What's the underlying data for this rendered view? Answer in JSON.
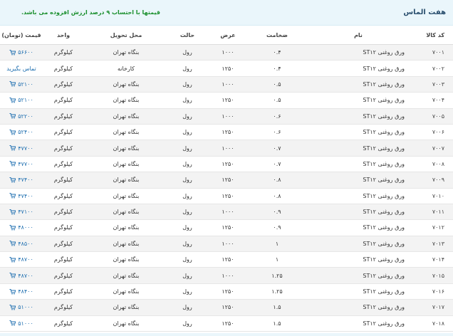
{
  "brand": "هفت الماس",
  "notice": "قیمتها با احتساب ۹ درصد ارزش افزوده می باشد.",
  "headers": {
    "code": "کد کالا",
    "name": "نام",
    "thickness": "ضخامت",
    "width": "عرض",
    "form": "حالت",
    "delivery": "محل تحویل",
    "unit": "واحد",
    "price": "قیمت (تومان)"
  },
  "rows": [
    {
      "code": "۷۰۰۱",
      "name": "ورق روغنی ST۱۲",
      "thickness": "۰.۴",
      "width": "۱۰۰۰",
      "form": "رول",
      "delivery": "بنگاه تهران",
      "unit": "کیلوگرم",
      "price": "۵۶۶۰۰",
      "has_cart": true
    },
    {
      "code": "۷۰۰۲",
      "name": "ورق روغنی ST۱۲",
      "thickness": "۰.۴",
      "width": "۱۲۵۰",
      "form": "رول",
      "delivery": "کارخانه",
      "unit": "کیلوگرم",
      "price": "تماس بگیرید",
      "has_cart": false
    },
    {
      "code": "۷۰۰۳",
      "name": "ورق روغنی ST۱۲",
      "thickness": "۰.۵",
      "width": "۱۰۰۰",
      "form": "رول",
      "delivery": "بنگاه تهران",
      "unit": "کیلوگرم",
      "price": "۵۲۱۰۰",
      "has_cart": true
    },
    {
      "code": "۷۰۰۴",
      "name": "ورق روغنی ST۱۲",
      "thickness": "۰.۵",
      "width": "۱۲۵۰",
      "form": "رول",
      "delivery": "بنگاه تهران",
      "unit": "کیلوگرم",
      "price": "۵۲۱۰۰",
      "has_cart": true
    },
    {
      "code": "۷۰۰۵",
      "name": "ورق روغنی ST۱۲",
      "thickness": "۰.۶",
      "width": "۱۰۰۰",
      "form": "رول",
      "delivery": "بنگاه تهران",
      "unit": "کیلوگرم",
      "price": "۵۲۲۰۰",
      "has_cart": true
    },
    {
      "code": "۷۰۰۶",
      "name": "ورق روغنی ST۱۲",
      "thickness": "۰.۶",
      "width": "۱۲۵۰",
      "form": "رول",
      "delivery": "بنگاه تهران",
      "unit": "کیلوگرم",
      "price": "۵۲۴۰۰",
      "has_cart": true
    },
    {
      "code": "۷۰۰۷",
      "name": "ورق روغنی ST۱۲",
      "thickness": "۰.۷",
      "width": "۱۰۰۰",
      "form": "رول",
      "delivery": "بنگاه تهران",
      "unit": "کیلوگرم",
      "price": "۴۷۷۰۰",
      "has_cart": true
    },
    {
      "code": "۷۰۰۸",
      "name": "ورق روغنی ST۱۲",
      "thickness": "۰.۷",
      "width": "۱۲۵۰",
      "form": "رول",
      "delivery": "بنگاه تهران",
      "unit": "کیلوگرم",
      "price": "۴۷۷۰۰",
      "has_cart": true
    },
    {
      "code": "۷۰۰۹",
      "name": "ورق روغنی ST۱۲",
      "thickness": "۰.۸",
      "width": "۱۲۵۰",
      "form": "رول",
      "delivery": "بنگاه تهران",
      "unit": "کیلوگرم",
      "price": "۴۷۴۰۰",
      "has_cart": true
    },
    {
      "code": "۷۰۱۰",
      "name": "ورق روغنی ST۱۲",
      "thickness": "۰.۸",
      "width": "۱۲۵۰",
      "form": "رول",
      "delivery": "بنگاه تهران",
      "unit": "کیلوگرم",
      "price": "۴۷۴۰۰",
      "has_cart": true
    },
    {
      "code": "۷۰۱۱",
      "name": "ورق روغنی ST۱۲",
      "thickness": "۰.۹",
      "width": "۱۰۰۰",
      "form": "رول",
      "delivery": "بنگاه تهران",
      "unit": "کیلوگرم",
      "price": "۴۷۱۰۰",
      "has_cart": true
    },
    {
      "code": "۷۰۱۲",
      "name": "ورق روغنی ST۱۲",
      "thickness": "۰.۹",
      "width": "۱۲۵۰",
      "form": "رول",
      "delivery": "بنگاه تهران",
      "unit": "کیلوگرم",
      "price": "۴۸۰۰۰",
      "has_cart": true
    },
    {
      "code": "۷۰۱۳",
      "name": "ورق روغنی ST۱۲",
      "thickness": "۱",
      "width": "۱۰۰۰",
      "form": "رول",
      "delivery": "بنگاه تهران",
      "unit": "کیلوگرم",
      "price": "۴۸۵۰۰",
      "has_cart": true
    },
    {
      "code": "۷۰۱۴",
      "name": "ورق روغنی ST۱۲",
      "thickness": "۱",
      "width": "۱۲۵۰",
      "form": "رول",
      "delivery": "بنگاه تهران",
      "unit": "کیلوگرم",
      "price": "۴۸۷۰۰",
      "has_cart": true
    },
    {
      "code": "۷۰۱۵",
      "name": "ورق روغنی ST۱۲",
      "thickness": "۱.۲۵",
      "width": "۱۰۰۰",
      "form": "رول",
      "delivery": "بنگاه تهران",
      "unit": "کیلوگرم",
      "price": "۴۸۷۰۰",
      "has_cart": true
    },
    {
      "code": "۷۰۱۶",
      "name": "ورق روغنی ST۱۲",
      "thickness": "۱.۲۵",
      "width": "۱۲۵۰",
      "form": "رول",
      "delivery": "بنگاه تهران",
      "unit": "کیلوگرم",
      "price": "۴۸۴۰۰",
      "has_cart": true
    },
    {
      "code": "۷۰۱۷",
      "name": "ورق روغنی ST۱۲",
      "thickness": "۱.۵",
      "width": "۱۲۵۰",
      "form": "رول",
      "delivery": "بنگاه تهران",
      "unit": "کیلوگرم",
      "price": "۵۱۰۰۰",
      "has_cart": true
    },
    {
      "code": "۷۰۱۸",
      "name": "ورق روغنی ST۱۲",
      "thickness": "۱.۵",
      "width": "۱۲۵۰",
      "form": "رول",
      "delivery": "بنگاه تهران",
      "unit": "کیلوگرم",
      "price": "۵۱۰۰۰",
      "has_cart": true
    }
  ],
  "icons": {
    "cart": "cart-icon"
  },
  "colors": {
    "accent": "#1f6fb0",
    "notice": "#1a8f2d",
    "header_bg": "#eaf6fb"
  }
}
